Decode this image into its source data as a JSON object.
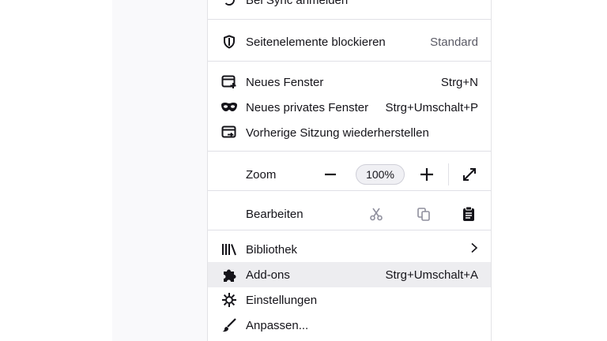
{
  "menu": {
    "sync": {
      "label": "Bei Sync anmelden"
    },
    "tracking": {
      "label": "Seitenelemente blockieren",
      "value": "Standard"
    },
    "new_window": {
      "label": "Neues Fenster",
      "shortcut": "Strg+N"
    },
    "private_window": {
      "label": "Neues privates Fenster",
      "shortcut": "Strg+Umschalt+P"
    },
    "restore_session": {
      "label": "Vorherige Sitzung wiederherstellen"
    },
    "zoom": {
      "label": "Zoom",
      "value": "100%",
      "minus": "−",
      "plus": "+"
    },
    "edit": {
      "label": "Bearbeiten"
    },
    "library": {
      "label": "Bibliothek"
    },
    "addons": {
      "label": "Add-ons",
      "shortcut": "Strg+Umschalt+A"
    },
    "settings": {
      "label": "Einstellungen"
    },
    "customize": {
      "label": "Anpassen..."
    }
  },
  "colors": {
    "text": "#15141a",
    "muted": "#5b5b66",
    "hover": "#ededf0",
    "separator": "#e0e0e6",
    "disabled_icon": "#8f8f9d"
  }
}
